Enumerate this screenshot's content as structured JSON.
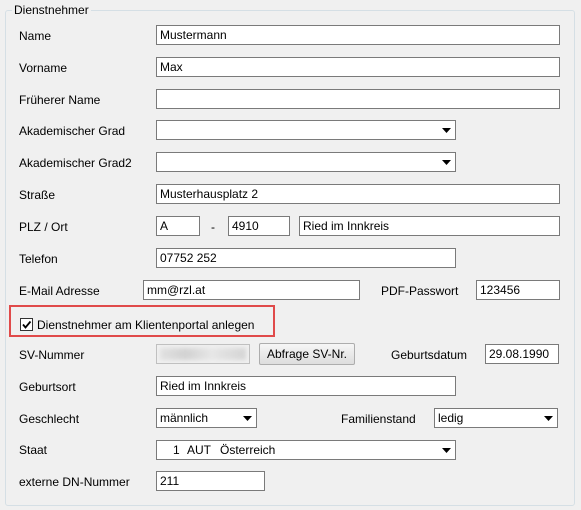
{
  "group_title": "Dienstnehmer",
  "fields": {
    "name": {
      "label": "Name",
      "value": "Mustermann"
    },
    "vorname": {
      "label": "Vorname",
      "value": "Max"
    },
    "frueherer_name": {
      "label": "Früherer Name",
      "value": ""
    },
    "akad_grad": {
      "label": "Akademischer Grad",
      "value": ""
    },
    "akad_grad2": {
      "label": "Akademischer Grad2",
      "value": ""
    },
    "strasse": {
      "label": "Straße",
      "value": "Musterhausplatz 2"
    },
    "plz_ort": {
      "label": "PLZ / Ort",
      "country": "A",
      "separator": "-",
      "plz": "4910",
      "ort": "Ried im Innkreis"
    },
    "telefon": {
      "label": "Telefon",
      "value": "07752 252"
    },
    "email": {
      "label": "E-Mail Adresse",
      "value": "mm@rzl.at"
    },
    "pdf_passwort": {
      "label": "PDF-Passwort",
      "value": "123456"
    },
    "klientenportal": {
      "label": "Dienstnehmer am Klientenportal anlegen",
      "checked": true
    },
    "sv_nummer": {
      "label": "SV-Nummer",
      "value": ""
    },
    "abfrage_sv": {
      "label": "Abfrage SV-Nr."
    },
    "geburtsdatum": {
      "label": "Geburtsdatum",
      "value": "29.08.1990"
    },
    "geburtsort": {
      "label": "Geburtsort",
      "value": "Ried im Innkreis"
    },
    "geschlecht": {
      "label": "Geschlecht",
      "value": "männlich"
    },
    "familienstand": {
      "label": "Familienstand",
      "value": "ledig"
    },
    "staat": {
      "label": "Staat",
      "code_num": "1",
      "code": "AUT",
      "name": "Österreich"
    },
    "externe_dn": {
      "label": "externe DN-Nummer",
      "value": "211"
    }
  },
  "highlight_color": "#e04a4a"
}
